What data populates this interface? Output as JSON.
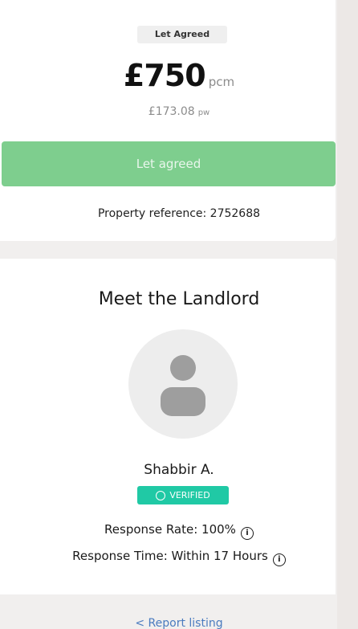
{
  "listing": {
    "status_tag": "Let Agreed",
    "price_amount": "£750",
    "price_unit": "pcm",
    "weekly_amount": "£173.08",
    "weekly_unit": "pw",
    "cta_label": "Let agreed",
    "reference_text": "Property reference: 2752688"
  },
  "landlord": {
    "section_title": "Meet the Landlord",
    "avatar_icon": "user-placeholder-icon",
    "name": "Shabbir A.",
    "verified_label": "VERIFIED",
    "response_rate": "Response Rate: 100%",
    "response_time": "Response Time: Within 17 Hours",
    "info_icon": "info-circle-icon"
  },
  "footer": {
    "link_text": "< Report listing"
  },
  "colors": {
    "cta_green": "#7ece8e",
    "verified_teal": "#20c9a5",
    "link_blue": "#4a7bbf"
  }
}
